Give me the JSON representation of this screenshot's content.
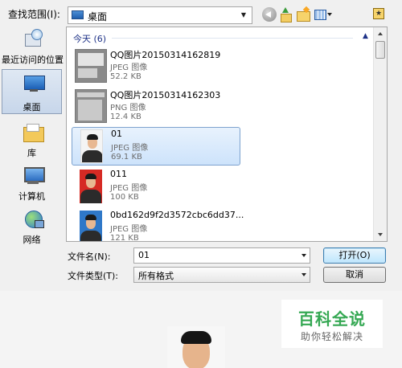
{
  "dialog": {
    "look_in_label": "查找范围(I):",
    "look_in_value": "桌面",
    "places": [
      {
        "label": "最近访问的位置",
        "icon": "recent-places-icon"
      },
      {
        "label": "桌面",
        "icon": "desktop-icon"
      },
      {
        "label": "库",
        "icon": "libraries-icon"
      },
      {
        "label": "计算机",
        "icon": "computer-icon"
      },
      {
        "label": "网络",
        "icon": "network-icon"
      }
    ],
    "group_header": "今天 (6)",
    "files": [
      {
        "name": "QQ图片20150314162819",
        "type": "JPEG 图像",
        "size": "52.2 KB",
        "thumb": "screenshot"
      },
      {
        "name": "QQ图片20150314162303",
        "type": "PNG 图像",
        "size": "12.4 KB",
        "thumb": "screenshot"
      },
      {
        "name": "01",
        "type": "JPEG 图像",
        "size": "69.1 KB",
        "thumb": "portrait-white",
        "selected": true
      },
      {
        "name": "011",
        "type": "JPEG 图像",
        "size": "100 KB",
        "thumb": "portrait-red"
      },
      {
        "name": "0bd162d9f2d3572cbc6dd37...",
        "type": "JPEG 图像",
        "size": "121 KB",
        "thumb": "portrait-blue"
      }
    ],
    "file_name_label": "文件名(N):",
    "file_name_value": "01",
    "file_type_label": "文件类型(T):",
    "file_type_value": "所有格式",
    "open_button": "打开(O)",
    "cancel_button": "取消"
  },
  "watermark": {
    "title": "百科全说",
    "subtitle": "助你轻松解决"
  },
  "colors": {
    "selection": "#cde3fb",
    "watermark_green": "#35a853",
    "group_header": "#1e3287"
  }
}
